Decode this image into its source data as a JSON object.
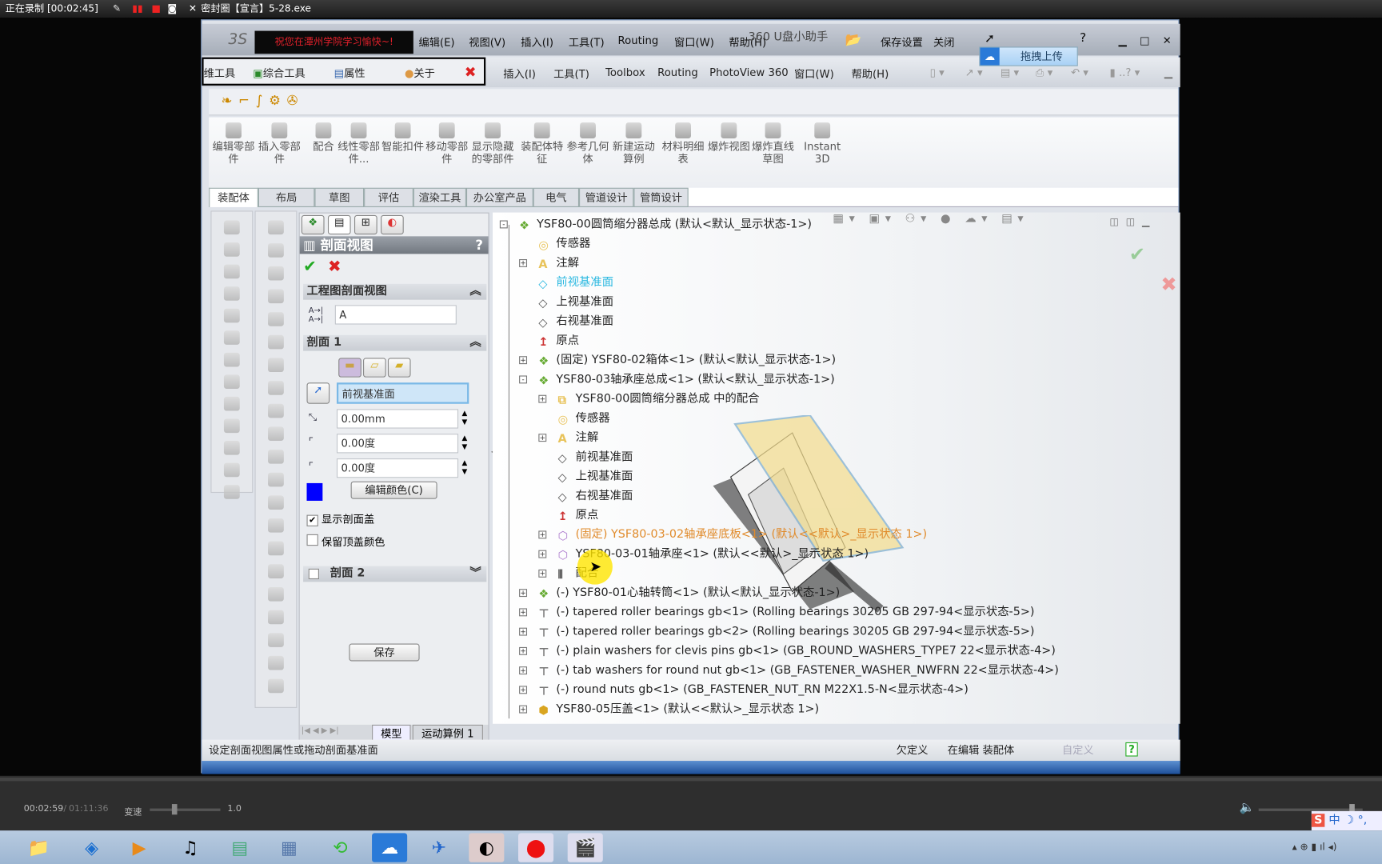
{
  "recorder": {
    "status": "正在录制 [00:02:45]",
    "window_title": "密封圈【宣言】5-28.exe"
  },
  "menu1": {
    "banner": "祝您在潭州学院学习愉快~!",
    "items": [
      "编辑(E)",
      "视图(V)",
      "插入(I)",
      "工具(T)",
      "Routing",
      "窗口(W)",
      "帮助(H)"
    ],
    "overlay": "360 U盘小助手",
    "save_settings": "保存设置",
    "close": "关闭"
  },
  "tooltip": {
    "label": "拖拽上传"
  },
  "menu2": {
    "addins": [
      "维工具",
      "综合工具",
      "属性",
      "关于"
    ],
    "items": [
      "插入(I)",
      "工具(T)",
      "Toolbox",
      "Routing",
      "PhotoView 360",
      "窗口(W)",
      "帮助(H)"
    ]
  },
  "ribbon": {
    "commands": [
      "编辑零部件",
      "插入零部件",
      "配合",
      "线性零部件...",
      "智能扣件",
      "移动零部件",
      "显示隐藏的零部件",
      "装配体特征",
      "参考几何体",
      "新建运动算例",
      "材料明细表",
      "爆炸视图",
      "爆炸直线草图",
      "Instant3D"
    ]
  },
  "tabs": [
    "装配体",
    "布局",
    "草图",
    "评估",
    "渲染工具",
    "办公室产品",
    "电气",
    "管道设计",
    "管筒设计"
  ],
  "pm": {
    "title": "剖面视图",
    "help": "?",
    "section_drawing": "工程图剖面视图",
    "label_value": "A",
    "section1": "剖面 1",
    "plane": "前视基准面",
    "offset": "0.00mm",
    "angle_x": "0.00度",
    "angle_y": "0.00度",
    "edit_color": "编辑颜色(C)",
    "show_cap": "显示剖面盖",
    "show_cap_checked": true,
    "keep_cap_color": "保留顶盖颜色",
    "keep_cap_color_checked": false,
    "section2": "剖面 2",
    "save": "保存",
    "cap_color": "#0000ff"
  },
  "tree": {
    "items": [
      {
        "level": 0,
        "exp": "-",
        "icon": "assembly",
        "text": "YSF80-00圆筒缩分器总成 (默认<默认_显示状态-1>)"
      },
      {
        "level": 1,
        "exp": "",
        "icon": "sensor",
        "text": "传感器"
      },
      {
        "level": 1,
        "exp": "+",
        "icon": "annotation",
        "text": "注解"
      },
      {
        "level": 1,
        "exp": "",
        "icon": "plane-active",
        "text": "前视基准面",
        "color": "#2ab8e0"
      },
      {
        "level": 1,
        "exp": "",
        "icon": "plane",
        "text": "上视基准面"
      },
      {
        "level": 1,
        "exp": "",
        "icon": "plane",
        "text": "右视基准面"
      },
      {
        "level": 1,
        "exp": "",
        "icon": "origin",
        "text": "原点"
      },
      {
        "level": 1,
        "exp": "+",
        "icon": "assembly",
        "text": "(固定) YSF80-02箱体<1> (默认<默认_显示状态-1>)"
      },
      {
        "level": 1,
        "exp": "-",
        "icon": "assembly",
        "text": "YSF80-03轴承座总成<1> (默认<默认_显示状态-1>)"
      },
      {
        "level": 2,
        "exp": "+",
        "icon": "mates-folder",
        "text": "YSF80-00圆筒缩分器总成 中的配合"
      },
      {
        "level": 2,
        "exp": "",
        "icon": "sensor",
        "text": "传感器"
      },
      {
        "level": 2,
        "exp": "+",
        "icon": "annotation",
        "text": "注解"
      },
      {
        "level": 2,
        "exp": "",
        "icon": "plane",
        "text": "前视基准面"
      },
      {
        "level": 2,
        "exp": "",
        "icon": "plane",
        "text": "上视基准面"
      },
      {
        "level": 2,
        "exp": "",
        "icon": "plane",
        "text": "右视基准面"
      },
      {
        "level": 2,
        "exp": "",
        "icon": "origin",
        "text": "原点"
      },
      {
        "level": 2,
        "exp": "+",
        "icon": "part",
        "text": "(固定) YSF80-03-02轴承座底板<1> (默认<<默认>_显示状态 1>)",
        "color": "#e08a2a"
      },
      {
        "level": 2,
        "exp": "+",
        "icon": "part",
        "text": "YSF80-03-01轴承座<1> (默认<<默认>_显示状态 1>)"
      },
      {
        "level": 2,
        "exp": "+",
        "icon": "mates",
        "text": "配合"
      },
      {
        "level": 1,
        "exp": "+",
        "icon": "assembly",
        "text": "(-) YSF80-01心轴转筒<1> (默认<默认_显示状态-1>)"
      },
      {
        "level": 1,
        "exp": "+",
        "icon": "bolt",
        "text": "(-) tapered roller bearings gb<1> (Rolling bearings 30205 GB 297-94<显示状态-5>)"
      },
      {
        "level": 1,
        "exp": "+",
        "icon": "bolt",
        "text": "(-) tapered roller bearings gb<2> (Rolling bearings 30205 GB 297-94<显示状态-5>)"
      },
      {
        "level": 1,
        "exp": "+",
        "icon": "bolt",
        "text": "(-) plain washers for clevis pins gb<1> (GB_ROUND_WASHERS_TYPE7 22<显示状态-4>)"
      },
      {
        "level": 1,
        "exp": "+",
        "icon": "bolt",
        "text": "(-) tab washers for round nut gb<1> (GB_FASTENER_WASHER_NWFRN 22<显示状态-4>)"
      },
      {
        "level": 1,
        "exp": "+",
        "icon": "bolt",
        "text": "(-) round nuts gb<1> (GB_FASTENER_NUT_RN M22X1.5-N<显示状态-4>)"
      },
      {
        "level": 1,
        "exp": "+",
        "icon": "part-gold",
        "text": "YSF80-05压盖<1> (默认<<默认>_显示状态 1>)"
      }
    ]
  },
  "bottom_tabs": [
    "模型",
    "运动算例 1"
  ],
  "status": {
    "message": "设定剖面视图属性或拖动剖面基准面",
    "state": "欠定义",
    "mode": "在编辑 装配体",
    "custom": "自定义",
    "help": "?"
  },
  "player": {
    "current": "00:02:59",
    "total": "01:11:36",
    "speed_label": "变速",
    "speed": "1.0",
    "volume": 0.9,
    "speed_slider": 0.35
  },
  "tray": {
    "ime": "中"
  }
}
